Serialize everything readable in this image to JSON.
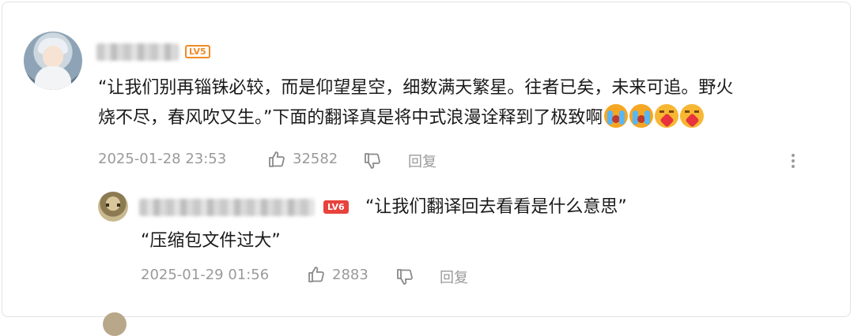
{
  "comment": {
    "level_badge": "LV5",
    "text_line1": "“让我们别再锱铢必较，而是仰望星空，细数满天繁星。往者已矣，未来可追。野火",
    "text_line2": "烧不尽，春风吹又生。”下面的翻译真是将中式浪漫诠释到了极致啊",
    "emojis": [
      "crying-emoji",
      "crying-emoji",
      "hug-heart-emoji",
      "hug-heart-emoji"
    ],
    "timestamp": "2025-01-28 23:53",
    "likes": "32582",
    "reply_label": "回复"
  },
  "reply": {
    "level_badge": "LV6",
    "text_line1": "“让我们翻译回去看看是什么意思”",
    "text_line2": "“压缩包文件过大”",
    "timestamp": "2025-01-29 01:56",
    "likes": "2883",
    "reply_label": "回复"
  },
  "colors": {
    "badge_orange": "#f08a24",
    "badge_red": "#e8423c",
    "meta_gray": "#9a9a9a"
  }
}
